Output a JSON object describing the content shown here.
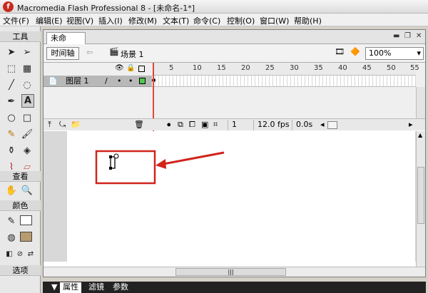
{
  "window": {
    "title": "Macromedia Flash Professional 8 - [未命名-1*]",
    "icon_letter": "f"
  },
  "menu": [
    "文件(F)",
    "编辑(E)",
    "视图(V)",
    "插入(I)",
    "修改(M)",
    "文本(T)",
    "命令(C)",
    "控制(O)",
    "窗口(W)",
    "帮助(H)"
  ],
  "toolbox": {
    "tools_header": "工具",
    "view_header": "查看",
    "color_header": "颜色",
    "options_header": "选项"
  },
  "document": {
    "tab_title": "未命名-1*",
    "timeline_button": "时间轴",
    "scene_label": "场景 1",
    "zoom": "100%"
  },
  "timeline": {
    "layer_name": "图层 1",
    "ruler_numbers": [
      "5",
      "10",
      "15",
      "20",
      "25",
      "30",
      "35",
      "40",
      "45",
      "50",
      "55"
    ],
    "current_frame": "1",
    "frame_rate": "12.0 fps",
    "elapsed_time": "0.0s"
  },
  "properties": {
    "tabs": [
      "属性",
      "滤镜",
      "参数"
    ]
  },
  "annotation": {
    "box_color": "#d0241c",
    "arrow_color": "#d0241c"
  }
}
